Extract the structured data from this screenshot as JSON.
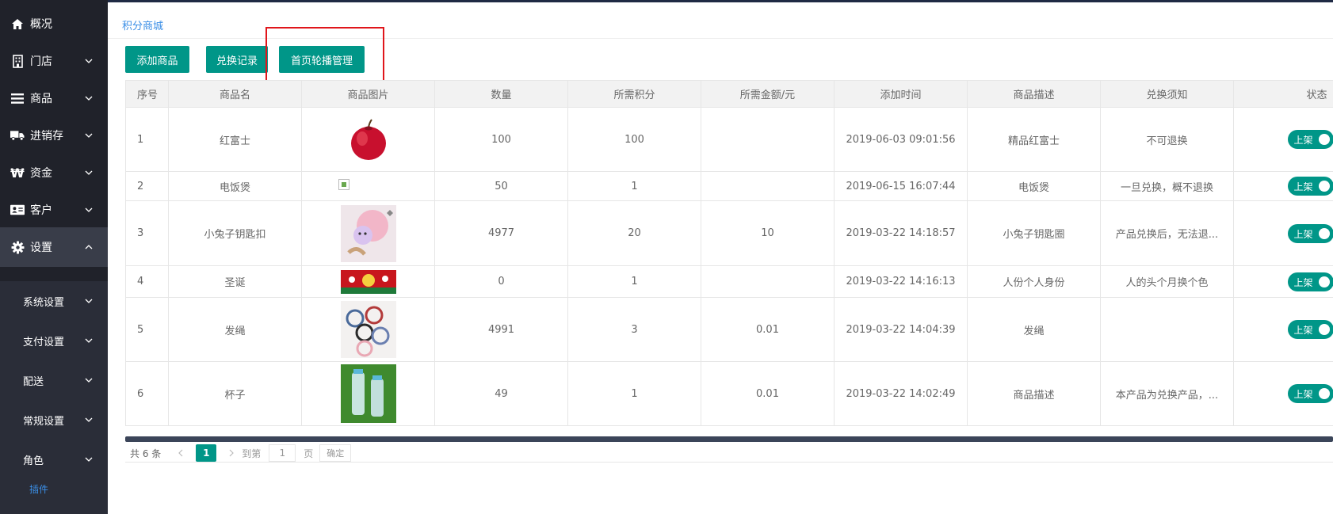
{
  "sidebar": {
    "items": [
      {
        "label": "概况",
        "icon": "home-icon"
      },
      {
        "label": "门店",
        "icon": "building-icon"
      },
      {
        "label": "商品",
        "icon": "list-icon"
      },
      {
        "label": "进销存",
        "icon": "truck-icon"
      },
      {
        "label": "资金",
        "icon": "won-icon"
      },
      {
        "label": "客户",
        "icon": "id-card-icon"
      },
      {
        "label": "设置",
        "icon": "gear-icon"
      }
    ],
    "subitems": [
      {
        "label": "系统设置"
      },
      {
        "label": "支付设置"
      },
      {
        "label": "配送"
      },
      {
        "label": "常规设置"
      },
      {
        "label": "角色"
      },
      {
        "label": "插件"
      }
    ]
  },
  "breadcrumb": "积分商城",
  "toolbar": {
    "add_label": "添加商品",
    "records_label": "兑换记录",
    "carousel_label": "首页轮播管理"
  },
  "table": {
    "headers": [
      "序号",
      "商品名",
      "商品图片",
      "数量",
      "所需积分",
      "所需金额/元",
      "添加时间",
      "商品描述",
      "兑换须知",
      "状态"
    ],
    "rows": [
      {
        "idx": "1",
        "name": "红富士",
        "image": "apple",
        "qty": "100",
        "points": "100",
        "amount": "",
        "time": "2019-06-03 09:01:56",
        "desc": "精品红富士",
        "notice": "不可退换",
        "status": "上架"
      },
      {
        "idx": "2",
        "name": "电饭煲",
        "image": "broken",
        "qty": "50",
        "points": "1",
        "amount": "",
        "time": "2019-06-15 16:07:44",
        "desc": "电饭煲",
        "notice": "一旦兑换，概不退换",
        "status": "上架"
      },
      {
        "idx": "3",
        "name": "小兔子钥匙扣",
        "image": "keychain",
        "qty": "4977",
        "points": "20",
        "amount": "10",
        "time": "2019-03-22 14:18:57",
        "desc": "小兔子钥匙圈",
        "notice": "产品兑换后，无法退...",
        "status": "上架"
      },
      {
        "idx": "4",
        "name": "圣诞",
        "image": "christmas",
        "qty": "0",
        "points": "1",
        "amount": "",
        "time": "2019-03-22 14:16:13",
        "desc": "人份个人身份",
        "notice": "人的头个月换个色",
        "status": "上架"
      },
      {
        "idx": "5",
        "name": "发绳",
        "image": "hairties",
        "qty": "4991",
        "points": "3",
        "amount": "0.01",
        "time": "2019-03-22 14:04:39",
        "desc": "发绳",
        "notice": "",
        "status": "上架"
      },
      {
        "idx": "6",
        "name": "杯子",
        "image": "cups",
        "qty": "49",
        "points": "1",
        "amount": "0.01",
        "time": "2019-03-22 14:02:49",
        "desc": "商品描述",
        "notice": "本产品为兑换产品，...",
        "status": "上架"
      }
    ]
  },
  "pager": {
    "total": "共 6 条",
    "current": "1",
    "goto": "到第",
    "input": "1",
    "page": "页",
    "confirm": "确定"
  },
  "colors": {
    "accent": "#009688",
    "sidebar": "#20222a",
    "link": "#3a8ee6",
    "highlight": "#e0161b"
  }
}
